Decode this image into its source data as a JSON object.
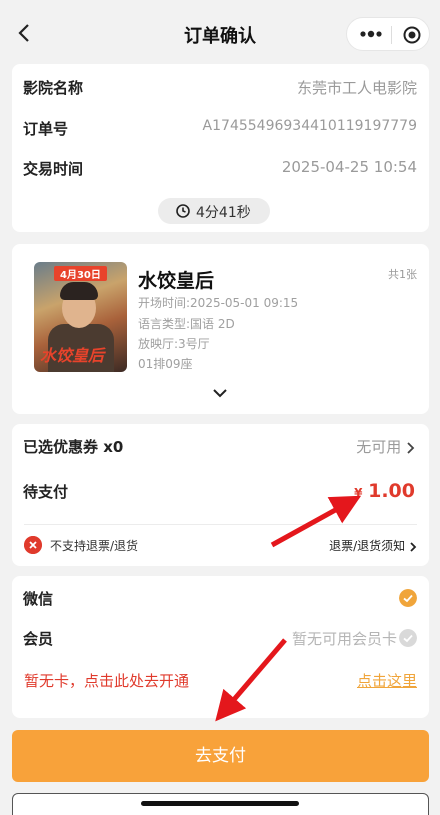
{
  "nav": {
    "title": "订单确认"
  },
  "cinema_card": {
    "rows": [
      {
        "label": "影院名称",
        "value": "东莞市工人电影院"
      },
      {
        "label": "订单号",
        "value": "A17455496934410119197779"
      },
      {
        "label": "交易时间",
        "value": "2025-04-25 10:54"
      }
    ],
    "countdown": "4分41秒"
  },
  "movie_card": {
    "poster_tag": "4月30日",
    "poster_title": "水饺皇后",
    "title": "水饺皇后",
    "ticket_count": "共1张",
    "showtime": "开场时间:2025-05-01 09:15",
    "language": "语言类型:国语 2D",
    "hall": "放映厅:3号厅",
    "seat": "01排09座"
  },
  "payment_card": {
    "coupon_label": "已选优惠券 x0",
    "coupon_value": "无可用",
    "due_label": "待支付",
    "currency": "¥",
    "amount": "1.00",
    "no_refund": "不支持退票/退货",
    "refund_link": "退票/退货须知"
  },
  "method_card": {
    "wechat_label": "微信",
    "member_label": "会员",
    "member_value": "暂无可用会员卡",
    "promo_text": "暂无卡，点击此处去开通",
    "promo_link": "点击这里"
  },
  "buttons": {
    "pay": "去支付"
  },
  "colors": {
    "accent": "#f8a23a",
    "price": "#e03a2c",
    "link": "#f0a53b"
  }
}
